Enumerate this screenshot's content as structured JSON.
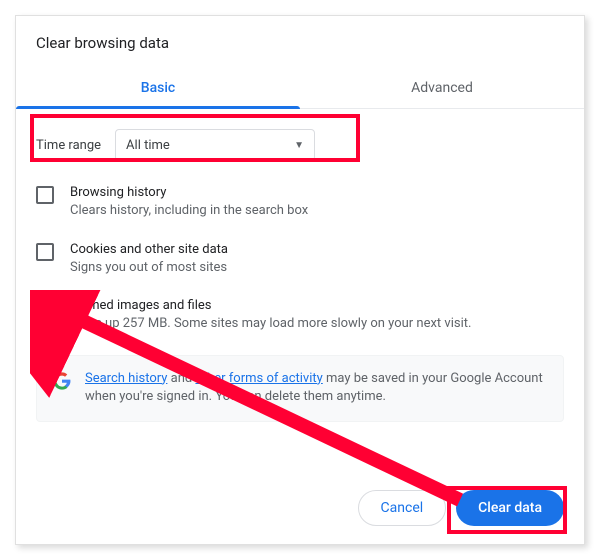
{
  "dialog": {
    "title": "Clear browsing data",
    "tabs": {
      "basic": "Basic",
      "advanced": "Advanced"
    },
    "time_range": {
      "label": "Time range",
      "value": "All time"
    },
    "options": [
      {
        "title": "Browsing history",
        "desc": "Clears history, including in the search box",
        "checked": false
      },
      {
        "title": "Cookies and other site data",
        "desc": "Signs you out of most sites",
        "checked": false
      },
      {
        "title": "Cached images and files",
        "desc": "Frees up 257 MB. Some sites may load more slowly on your next visit.",
        "checked": true
      }
    ],
    "info": {
      "link1": "Search history",
      "mid1": " and ",
      "link2": "other forms of activity",
      "rest": " may be saved in your Google Account when you're signed in. You can delete them anytime."
    },
    "buttons": {
      "cancel": "Cancel",
      "confirm": "Clear data"
    }
  }
}
